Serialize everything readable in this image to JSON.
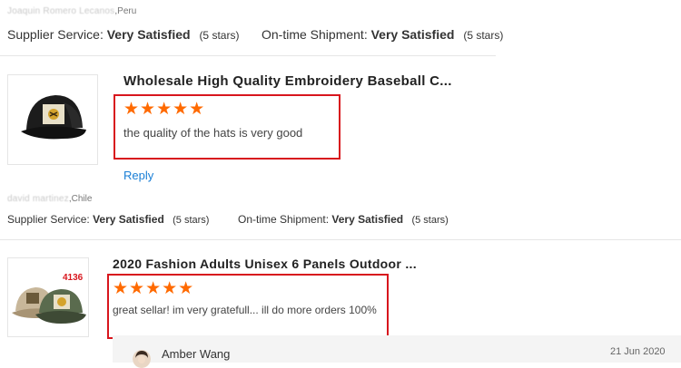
{
  "review_top": {
    "reviewer_name": "Joaquin Romero Lecanos",
    "reviewer_country": ",Peru",
    "supplier_service_label": "Supplier Service:",
    "supplier_service_value": "Very Satisfied",
    "supplier_service_stars": "(5 stars)",
    "ontime_label": "On-time Shipment:",
    "ontime_value": "Very Satisfied",
    "ontime_stars": "(5 stars)"
  },
  "review_1": {
    "product_title": "Wholesale High Quality Embroidery Baseball C...",
    "rating": 5,
    "stars_text": "★★★★★",
    "comment": "the quality of the hats is very good",
    "reply_label": "Reply",
    "reviewer_name": "david martinez",
    "reviewer_country": ",Chile",
    "supplier_service_label": "Supplier Service:",
    "supplier_service_value": "Very Satisfied",
    "supplier_service_stars": "(5 stars)",
    "ontime_label": "On-time Shipment:",
    "ontime_value": "Very Satisfied",
    "ontime_stars": "(5 stars)",
    "thumbnail_icon": "baseball-cap-icon"
  },
  "review_2": {
    "product_title": "2020 Fashion Adults Unisex 6 Panels Outdoor ...",
    "rating": 5,
    "stars_text": "★★★★★",
    "comment": "great sellar! im very gratefull... ill do more orders 100%",
    "thumbnail_icon": "baseball-caps-icon",
    "thumbnail_code": "4136",
    "reply": {
      "author": "Amber Wang",
      "date": "21 Jun 2020"
    }
  },
  "colors": {
    "star": "#ff6a00",
    "highlight_box": "#d8161d",
    "link": "#1a7fd6"
  }
}
